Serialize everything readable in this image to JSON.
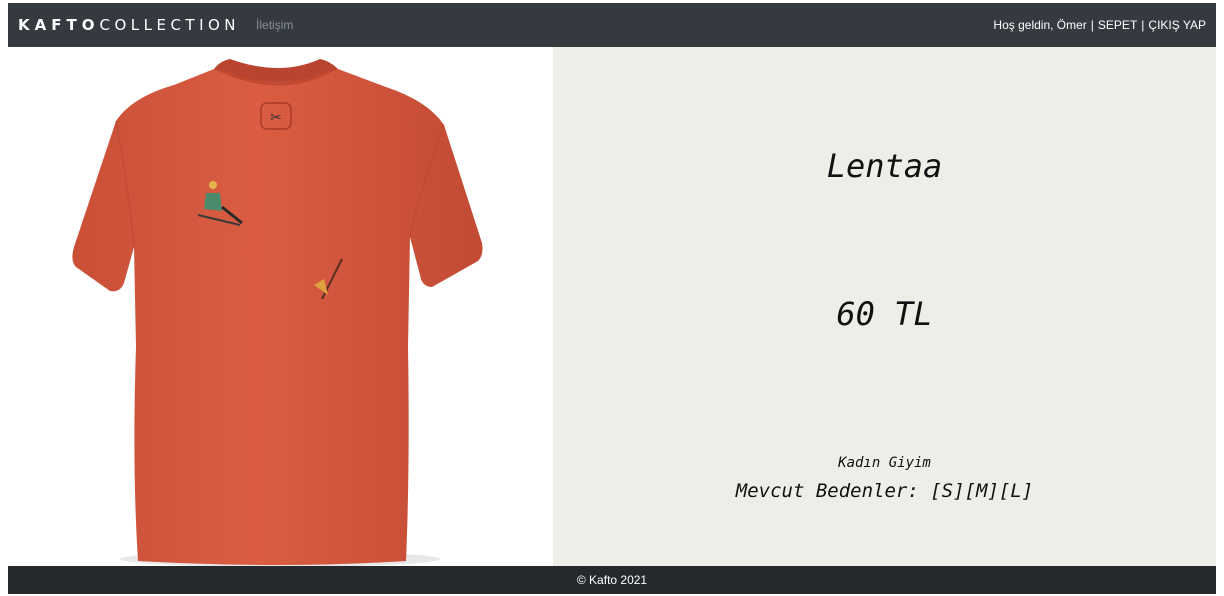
{
  "navbar": {
    "brand_bold": "KAFTO",
    "brand_light": "COLLECTION",
    "contact_link": "İletişim",
    "greeting": "Hoş geldin, Ömer",
    "separator": "|",
    "cart_link": "SEPET",
    "logout_link": "ÇIKIŞ YAP"
  },
  "product": {
    "image_icon": "tshirt-image",
    "name": "Lentaa",
    "price": "60 TL",
    "category": "Kadın Giyim",
    "sizes": "Mevcut Bedenler: [S][M][L]"
  },
  "footer": {
    "copyright": "© Kafto 2021"
  },
  "colors": {
    "navbar_bg": "#343a40",
    "panel_bg": "#efede8",
    "shirt": "#d6583f",
    "footer_bg": "#26292c"
  }
}
